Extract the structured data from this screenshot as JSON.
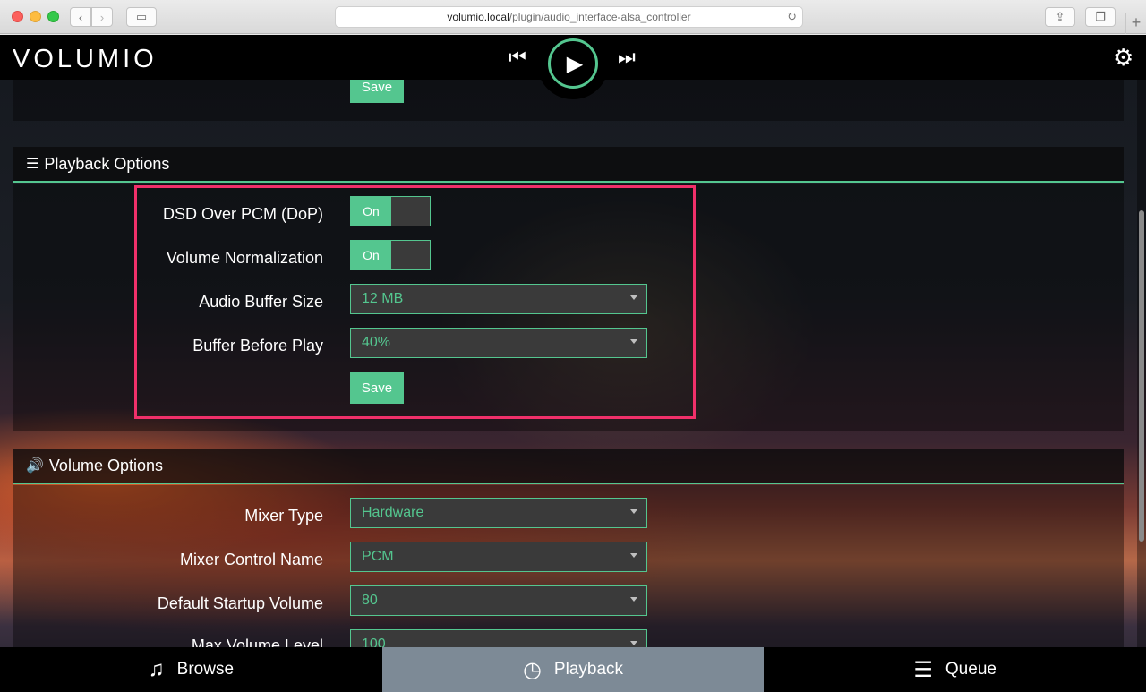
{
  "browser": {
    "url_host": "volumio.local",
    "url_path": "/plugin/audio_interface-alsa_controller"
  },
  "app": {
    "logo": "VOLUMIO"
  },
  "top_section": {
    "save_label": "Save"
  },
  "playback_options": {
    "title": "Playback Options",
    "dsd_label": "DSD Over PCM (DoP)",
    "dsd_state": "On",
    "volnorm_label": "Volume Normalization",
    "volnorm_state": "On",
    "buffer_label": "Audio Buffer Size",
    "buffer_value": "12 MB",
    "bbp_label": "Buffer Before Play",
    "bbp_value": "40%",
    "save_label": "Save"
  },
  "volume_options": {
    "title": "Volume Options",
    "mixer_type_label": "Mixer Type",
    "mixer_type_value": "Hardware",
    "mixer_control_label": "Mixer Control Name",
    "mixer_control_value": "PCM",
    "startup_volume_label": "Default Startup Volume",
    "startup_volume_value": "80",
    "max_volume_label": "Max Volume Level",
    "max_volume_value": "100"
  },
  "bottom_nav": {
    "browse": "Browse",
    "playback": "Playback",
    "queue": "Queue"
  },
  "colors": {
    "accent": "#54c68f",
    "highlight": "#f0306a"
  }
}
